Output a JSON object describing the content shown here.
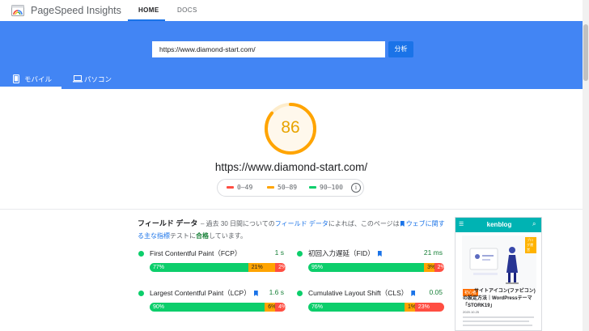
{
  "nav": {
    "brand": "PageSpeed Insights",
    "tabs": [
      {
        "label": "HOME",
        "active": true
      },
      {
        "label": "DOCS",
        "active": false
      }
    ]
  },
  "search": {
    "url_value": "https://www.diamond-start.com/",
    "analyze_label": "分析"
  },
  "device_tabs": [
    {
      "label": "モバイル",
      "icon": "smartphone-icon",
      "active": true
    },
    {
      "label": "パソコン",
      "icon": "laptop-icon",
      "active": false
    }
  ],
  "score": {
    "value": "86",
    "fraction": 0.86,
    "color": "#ffa400",
    "tested_url": "https://www.diamond-start.com/"
  },
  "legend": {
    "items": [
      {
        "label": "0–49",
        "color": "#ff4e42"
      },
      {
        "label": "50–89",
        "color": "#ffa400"
      },
      {
        "label": "90–100",
        "color": "#0cce6b"
      }
    ],
    "info_icon": "info-icon"
  },
  "field_data": {
    "title": "フィールド データ",
    "desc_part1": " – 過去 30 日間についての",
    "desc_link1": "フィールド データ",
    "desc_part2": "によれば、このページは",
    "desc_link2": "ウェブに関する主な指標",
    "desc_part3": "テストに",
    "desc_result": "合格",
    "desc_part4": "しています。",
    "metrics": [
      {
        "name": "First Contentful Paint（FCP）",
        "value": "1 s",
        "flag": false,
        "dist": [
          "77%",
          "21%",
          "2%"
        ],
        "fractions": [
          0.77,
          0.21,
          0.02
        ]
      },
      {
        "name": "初回入力遅延（FID）",
        "value": "21 ms",
        "flag": true,
        "dist": [
          "95%",
          "3%",
          "2%"
        ],
        "fractions": [
          0.95,
          0.03,
          0.02
        ]
      },
      {
        "name": "Largest Contentful Paint（LCP）",
        "value": "1.6 s",
        "flag": true,
        "dist": [
          "90%",
          "6%",
          "4%"
        ],
        "fractions": [
          0.9,
          0.06,
          0.04
        ]
      },
      {
        "name": "Cumulative Layout Shift（CLS）",
        "value": "0.05",
        "flag": true,
        "dist": [
          "76%",
          "1%",
          "23%"
        ],
        "fractions": [
          0.76,
          0.01,
          0.23
        ]
      }
    ]
  },
  "thumbnail": {
    "site_name": "kenblog",
    "tag": "ブログ運営",
    "category": "初心者",
    "title": "サイトアイコン(ファビコン)の設定方法｜WordPressテーマ「STORK19」",
    "date": "2020.10.25"
  }
}
